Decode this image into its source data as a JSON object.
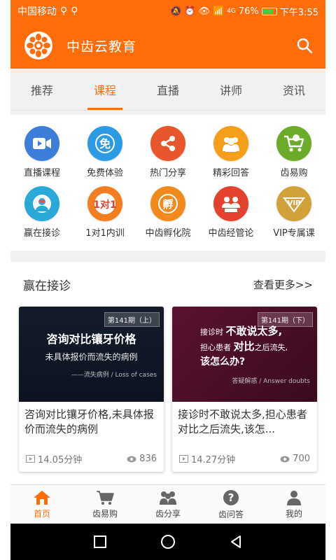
{
  "status_bar": {
    "carrier": "中国移动",
    "signal_text": "4G",
    "battery": "76%",
    "time": "下午3:55"
  },
  "app": {
    "title": "中齿云教育"
  },
  "tabs": [
    {
      "label": "推荐",
      "active": false
    },
    {
      "label": "课程",
      "active": true
    },
    {
      "label": "直播",
      "active": false
    },
    {
      "label": "讲师",
      "active": false
    },
    {
      "label": "资讯",
      "active": false
    }
  ],
  "grid": [
    {
      "label": "直播课程",
      "icon": "video-camera-icon",
      "color": "#3c7ed9"
    },
    {
      "label": "免费体验",
      "icon": "free-icon",
      "color": "#2d9be3"
    },
    {
      "label": "热门分享",
      "icon": "share-icon",
      "color": "#e8562d"
    },
    {
      "label": "精彩回答",
      "icon": "people-icon",
      "color": "#f59e1a"
    },
    {
      "label": "齿易购",
      "icon": "shopping-cart-icon",
      "color": "#6cab2a"
    },
    {
      "label": "赢在接诊",
      "icon": "doctor-icon",
      "color": "#2aa8d8"
    },
    {
      "label": "1对1内训",
      "icon": "one-on-one-icon",
      "color": "#f37d1f"
    },
    {
      "label": "中齿孵化院",
      "icon": "incubator-icon",
      "color": "#f08a1c"
    },
    {
      "label": "中齿经管论",
      "icon": "management-icon",
      "color": "#e4422e"
    },
    {
      "label": "VIP专属课",
      "icon": "vip-icon",
      "color": "#d2a23a"
    }
  ],
  "section": {
    "title": "赢在接诊",
    "more": "查看更多>>"
  },
  "cards": [
    {
      "issue": "第141期（上）",
      "thumb_line1": "咨询对比镶牙价格",
      "thumb_line2": "未具体报价而流失的病例",
      "thumb_foot": "——流失病例 / Loss of cases",
      "title": "咨询对比镶牙价格,未具体报价而流失的病例",
      "duration": "14.05分钟",
      "views": "836"
    },
    {
      "issue": "第141期（下）",
      "thumb_l1_prefix": "接诊时",
      "thumb_l1_bold": "不敢说太多,",
      "thumb_l2_prefix": "担心患者",
      "thumb_l2_bold": "对比",
      "thumb_l2_suffix": "之后流失,",
      "thumb_l3": "该怎么办?",
      "thumb_foot": "答疑解惑 / Answer doubts",
      "title": "接诊时不敢说太多,担心患者对比之后流失,该怎...",
      "duration": "14.27分钟",
      "views": "700"
    }
  ],
  "bottom_nav": [
    {
      "label": "首页",
      "icon": "home-icon",
      "active": true
    },
    {
      "label": "齿易购",
      "icon": "cart-icon",
      "active": false
    },
    {
      "label": "齿分享",
      "icon": "group-icon",
      "active": false
    },
    {
      "label": "齿问答",
      "icon": "question-icon",
      "active": false
    },
    {
      "label": "我的",
      "icon": "user-icon",
      "active": false
    }
  ],
  "colors": {
    "accent": "#ff6d0b",
    "background": "#f1f1f1"
  }
}
